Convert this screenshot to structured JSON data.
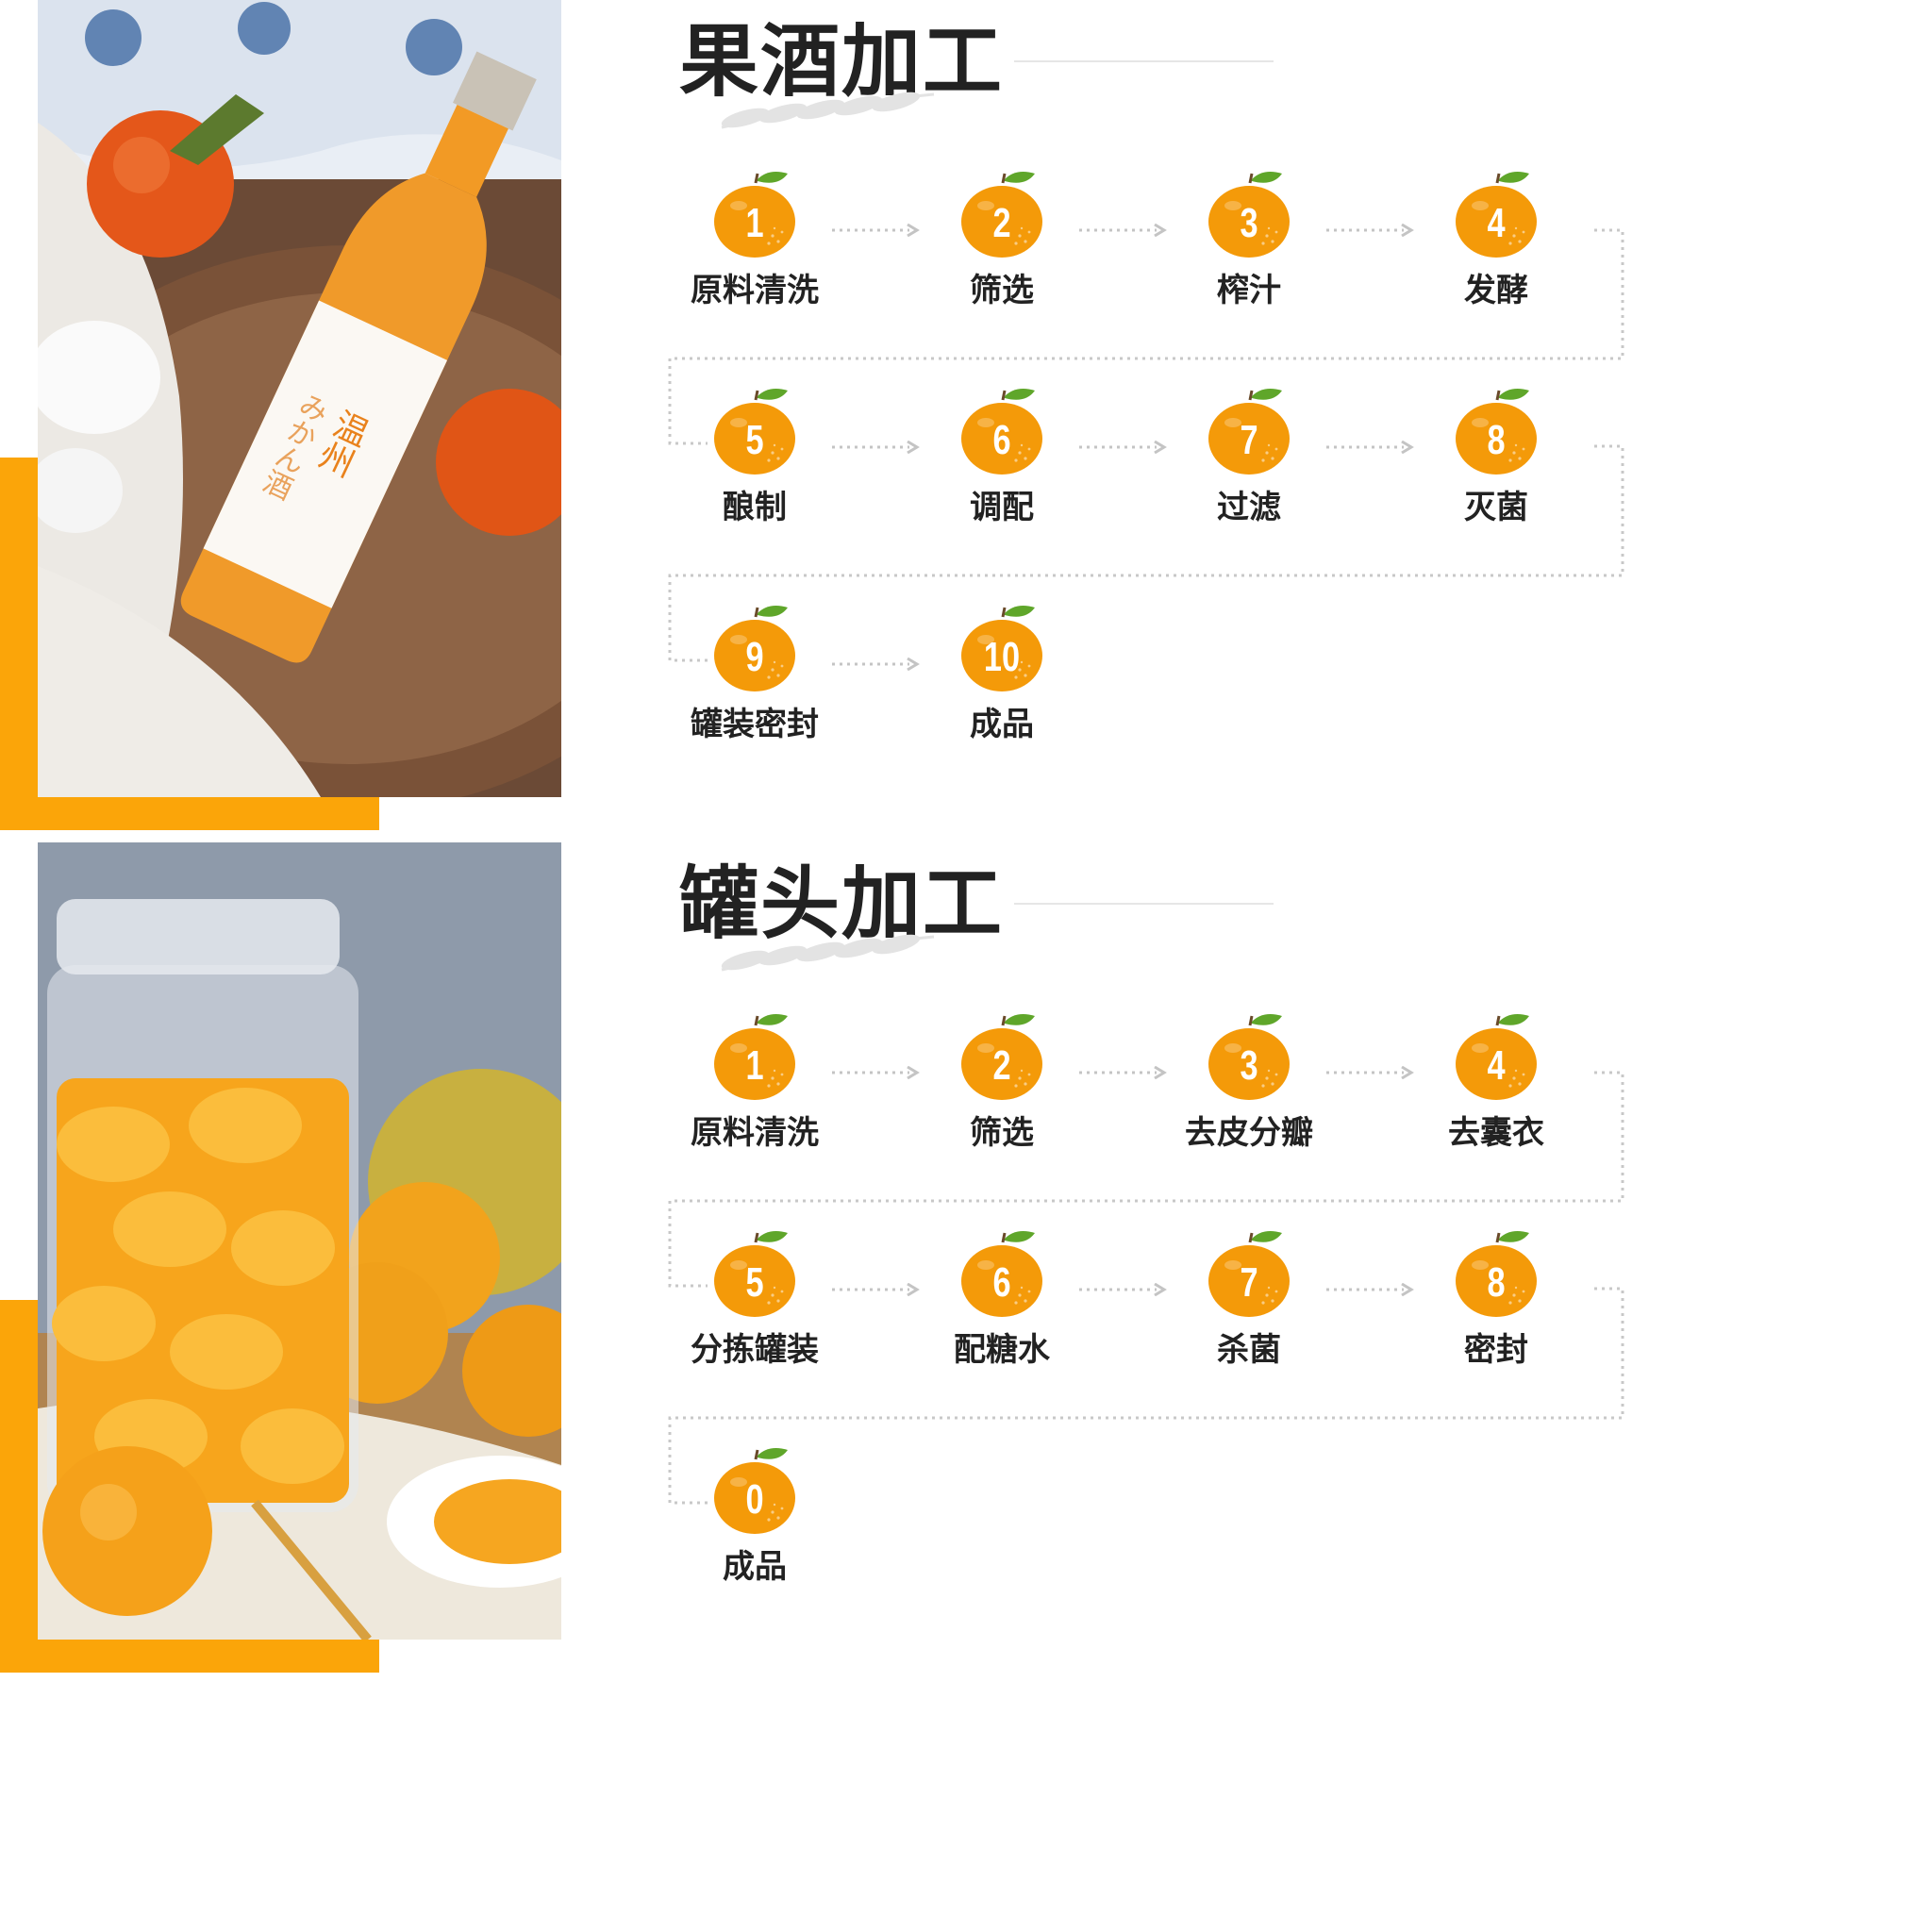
{
  "colors": {
    "accent": "#fba509",
    "badge": "#f49a09",
    "leaf": "#5fa62a",
    "text": "#222222"
  },
  "sections": [
    {
      "title": "果酒加工",
      "photo_icon": "wine-bottle-photo",
      "bottle_label": {
        "line1": "温州",
        "line2": "みかん酒"
      },
      "steps": [
        {
          "num": "1",
          "label": "原料清洗"
        },
        {
          "num": "2",
          "label": "筛选"
        },
        {
          "num": "3",
          "label": "榨汁"
        },
        {
          "num": "4",
          "label": "发酵"
        },
        {
          "num": "5",
          "label": "酿制"
        },
        {
          "num": "6",
          "label": "调配"
        },
        {
          "num": "7",
          "label": "过滤"
        },
        {
          "num": "8",
          "label": "灭菌"
        },
        {
          "num": "9",
          "label": "罐装密封"
        },
        {
          "num": "10",
          "label": "成品"
        }
      ]
    },
    {
      "title": "罐头加工",
      "photo_icon": "canned-orange-jar-photo",
      "steps": [
        {
          "num": "1",
          "label": "原料清洗"
        },
        {
          "num": "2",
          "label": "筛选"
        },
        {
          "num": "3",
          "label": "去皮分瓣"
        },
        {
          "num": "4",
          "label": "去囊衣"
        },
        {
          "num": "5",
          "label": "分拣罐装"
        },
        {
          "num": "6",
          "label": "配糖水"
        },
        {
          "num": "7",
          "label": "杀菌"
        },
        {
          "num": "8",
          "label": "密封"
        },
        {
          "num": "0",
          "label": "成品"
        }
      ]
    }
  ]
}
